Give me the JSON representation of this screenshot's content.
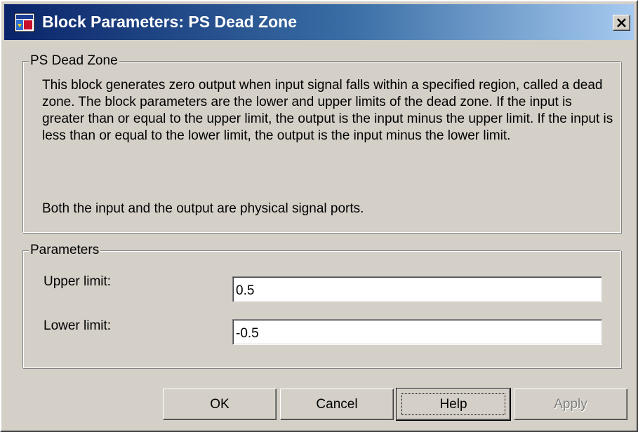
{
  "window": {
    "title": "Block Parameters: PS Dead Zone",
    "close_label": "Close"
  },
  "description": {
    "group_label": "PS Dead Zone",
    "text": "This block generates zero output when input signal falls within a specified region, called a dead zone. The block parameters are the lower and upper limits of the dead zone. If the input is greater than or equal to the upper limit, the output is the input minus the upper limit. If the input is less than or equal to the lower limit, the output is the input minus the lower limit.",
    "text2": "Both the input and the output are physical signal ports."
  },
  "parameters": {
    "group_label": "Parameters",
    "upper_limit_label": "Upper limit:",
    "upper_limit_value": "0.5",
    "lower_limit_label": "Lower limit:",
    "lower_limit_value": "-0.5"
  },
  "buttons": {
    "ok": "OK",
    "cancel": "Cancel",
    "help": "Help",
    "apply": "Apply"
  },
  "colors": {
    "title_gradient_start": "#0a246a",
    "title_gradient_end": "#a6caf0",
    "face": "#d4d0c8"
  },
  "icons": {
    "app": "simulink-block-icon",
    "close": "close-icon"
  }
}
